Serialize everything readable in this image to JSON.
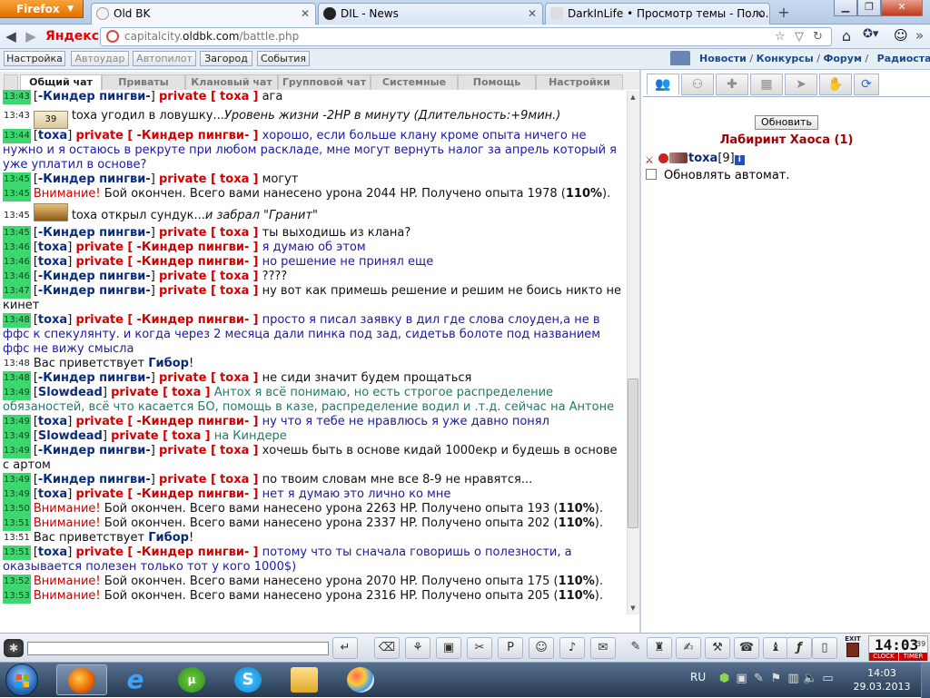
{
  "browser": {
    "app_button": "Firefox",
    "tabs": [
      {
        "label": "Old BK",
        "active": true
      },
      {
        "label": "DIL - News",
        "active": false
      },
      {
        "label": "DarkInLife • Просмотр темы - Поло...",
        "active": false
      }
    ],
    "new_tab": "+",
    "yandex": "Яндекс",
    "url_host": "capitalcity.",
    "url_domain": "oldbk.com",
    "url_path": "/battle.php"
  },
  "game_menu": {
    "buttons": [
      "Настройка",
      "Автоудар",
      "Автопилот",
      "Загород",
      "События"
    ],
    "links": [
      {
        "label": "Новости",
        "sep": " / "
      },
      {
        "label": "Конкурсы",
        "sep": " / "
      },
      {
        "label": "Форум",
        "sep": " / "
      },
      {
        "label": "Радиостанции",
        "sep": ""
      }
    ]
  },
  "chat_tabs": [
    "Общий чат",
    "Приваты",
    "Клановый чат",
    "Групповой чат",
    "Системные",
    "Помощь",
    "Настройки"
  ],
  "chat": [
    {
      "kind": "msg",
      "ts": "13:43",
      "bracket_open": "[",
      "nick": "-Киндер пингви-",
      "bracket_close": "]",
      "priv": "private [",
      "to": "toxa",
      "priv_close": "]",
      "text": "ага",
      "tone": "black",
      "ts_style": "green"
    },
    {
      "kind": "event",
      "ts": "13:43",
      "icon": "39",
      "actor": "toxa",
      "text": " угодил в ловушку...",
      "italic": "Уровень жизни -2HP в минуту (Длительность:+9мин.)"
    },
    {
      "kind": "msg",
      "ts": "13:44",
      "bracket_open": "[",
      "nick": "toxa",
      "bracket_close": "]",
      "priv": "private [",
      "to": "-Киндер пингви-",
      "priv_close": "]",
      "text": "хорошо, если больше клану кроме опыта ничего не нужно и я остаюсь в рекруте при любом раскладе, мне могут вернуть налог за апрель который я уже уплатил в основе?",
      "tone": "blue",
      "ts_style": "green"
    },
    {
      "kind": "msg",
      "ts": "13:45",
      "bracket_open": "[",
      "nick": "-Киндер пингви-",
      "bracket_close": "]",
      "priv": "private [",
      "to": "toxa",
      "priv_close": "]",
      "text": "могут",
      "tone": "black",
      "ts_style": "green"
    },
    {
      "kind": "system",
      "ts": "13:45",
      "warn": "Внимание!",
      "text": " Бой окончен. Всего вами нанесено урона 2044 HP. Получено опыта 1978 (",
      "pct": "110%",
      "tail": ")."
    },
    {
      "kind": "event",
      "ts": "13:45",
      "icon": "chest",
      "actor": "toxa",
      "text": " открыл сундук...",
      "italic": "и забрал \"Гранит\""
    },
    {
      "kind": "msg",
      "ts": "13:45",
      "bracket_open": "[",
      "nick": "-Киндер пингви-",
      "bracket_close": "]",
      "priv": "private [",
      "to": "toxa",
      "priv_close": "]",
      "text": "ты выходишь из клана?",
      "tone": "black",
      "ts_style": "green"
    },
    {
      "kind": "msg",
      "ts": "13:46",
      "bracket_open": "[",
      "nick": "toxa",
      "bracket_close": "]",
      "priv": "private [",
      "to": "-Киндер пингви-",
      "priv_close": "]",
      "text": "я думаю об этом",
      "tone": "blue",
      "ts_style": "green"
    },
    {
      "kind": "msg",
      "ts": "13:46",
      "bracket_open": "[",
      "nick": "toxa",
      "bracket_close": "]",
      "priv": "private [",
      "to": "-Киндер пингви-",
      "priv_close": "]",
      "text": "но решение не принял еще",
      "tone": "blue",
      "ts_style": "green"
    },
    {
      "kind": "msg",
      "ts": "13:46",
      "bracket_open": "[",
      "nick": "-Киндер пингви-",
      "bracket_close": "]",
      "priv": "private [",
      "to": "toxa",
      "priv_close": "]",
      "text": "????",
      "tone": "black",
      "ts_style": "green"
    },
    {
      "kind": "msg",
      "ts": "13:47",
      "bracket_open": "[",
      "nick": "-Киндер пингви-",
      "bracket_close": "]",
      "priv": "private [",
      "to": "toxa",
      "priv_close": "]",
      "text": "ну вот как примешь решение и решим не боись никто не кинет",
      "tone": "black",
      "ts_style": "green"
    },
    {
      "kind": "msg",
      "ts": "13:48",
      "bracket_open": "[",
      "nick": "toxa",
      "bracket_close": "]",
      "priv": "private [",
      "to": "-Киндер пингви-",
      "priv_close": "]",
      "text": "просто я писал заявку в дил где слова слоуден,а не в ффс к спекулянту. и когда через 2 месяца дали пинка под зад, сидетьв болоте под названием ффс не вижу смысла",
      "tone": "blue",
      "ts_style": "green"
    },
    {
      "kind": "greet",
      "ts": "13:48",
      "text": "Вас приветствует ",
      "name": "Гибор",
      "tail": "!"
    },
    {
      "kind": "msg",
      "ts": "13:48",
      "bracket_open": "[",
      "nick": "-Киндер пингви-",
      "bracket_close": "]",
      "priv": "private [",
      "to": "toxa",
      "priv_close": "]",
      "text": "не сиди значит будем прощаться",
      "tone": "black",
      "ts_style": "green"
    },
    {
      "kind": "msg",
      "ts": "13:49",
      "bracket_open": "[",
      "nick": "Slowdead",
      "bracket_close": "]",
      "priv": "private [",
      "to": "toxa",
      "priv_close": "]",
      "text": "Антох я всё понимаю, но есть строгое распределение обязаностей, всё что касается БО, помощь в казе, распределение водил и .т.д. сейчас на Антоне",
      "tone": "teal",
      "ts_style": "green"
    },
    {
      "kind": "msg",
      "ts": "13:49",
      "bracket_open": "[",
      "nick": "toxa",
      "bracket_close": "]",
      "priv": "private [",
      "to": "-Киндер пингви-",
      "priv_close": "]",
      "text": "ну что я тебе не нравлюсь я уже давно понял",
      "tone": "blue",
      "ts_style": "green"
    },
    {
      "kind": "msg",
      "ts": "13:49",
      "bracket_open": "[",
      "nick": "Slowdead",
      "bracket_close": "]",
      "priv": "private [",
      "to": "toxa",
      "priv_close": "]",
      "text": "на Киндере",
      "tone": "teal",
      "ts_style": "green"
    },
    {
      "kind": "msg",
      "ts": "13:49",
      "bracket_open": "[",
      "nick": "-Киндер пингви-",
      "bracket_close": "]",
      "priv": "private [",
      "to": "toxa",
      "priv_close": "]",
      "text": "хочешь быть в основе кидай 1000екр и будешь в основе с артом",
      "tone": "black",
      "ts_style": "green"
    },
    {
      "kind": "msg",
      "ts": "13:49",
      "bracket_open": "[",
      "nick": "-Киндер пингви-",
      "bracket_close": "]",
      "priv": "private [",
      "to": "toxa",
      "priv_close": "]",
      "text": "по твоим словам мне все 8-9 не нравятся...",
      "tone": "black",
      "ts_style": "green"
    },
    {
      "kind": "msg",
      "ts": "13:49",
      "bracket_open": "[",
      "nick": "toxa",
      "bracket_close": "]",
      "priv": "private [",
      "to": "-Киндер пингви-",
      "priv_close": "]",
      "text": "нет я думаю это лично ко мне",
      "tone": "blue",
      "ts_style": "green"
    },
    {
      "kind": "system",
      "ts": "13:50",
      "warn": "Внимание!",
      "text": " Бой окончен. Всего вами нанесено урона 2263 HP. Получено опыта 193 (",
      "pct": "110%",
      "tail": ")."
    },
    {
      "kind": "system",
      "ts": "13:51",
      "warn": "Внимание!",
      "text": " Бой окончен. Всего вами нанесено урона 2337 HP. Получено опыта 202 (",
      "pct": "110%",
      "tail": ")."
    },
    {
      "kind": "greet",
      "ts": "13:51",
      "text": "Вас приветствует ",
      "name": "Гибор",
      "tail": "!"
    },
    {
      "kind": "msg",
      "ts": "13:51",
      "bracket_open": "[",
      "nick": "toxa",
      "bracket_close": "]",
      "priv": "private [",
      "to": "-Киндер пингви-",
      "priv_close": "]",
      "text": "потому что ты сначала говоришь о полезности, а оказывается полезен только тот у кого 1000$)",
      "tone": "blue",
      "ts_style": "green"
    },
    {
      "kind": "system",
      "ts": "13:52",
      "warn": "Внимание!",
      "text": " Бой окончен. Всего вами нанесено урона 2070 HP. Получено опыта 175 (",
      "pct": "110%",
      "tail": ")."
    },
    {
      "kind": "system",
      "ts": "13:53",
      "warn": "Внимание!",
      "text": " Бой окончен. Всего вами нанесено урона 2316 HP. Получено опыта 205 (",
      "pct": "110%",
      "tail": ")."
    }
  ],
  "right": {
    "refresh_label": "Обновить",
    "room_title": "Лабиринт Хаоса (1)",
    "user": {
      "name": "toxa",
      "level": "[9]",
      "info": "i"
    },
    "auto_refresh_label": "Обновлять автомат.",
    "auto_refresh_checked": false
  },
  "clock": {
    "time": "14:03",
    "seconds": "39",
    "label_left": "CLOCK",
    "label_right": "TIMER"
  },
  "exit_label": "EXIT",
  "taskbar": {
    "lang": "RU",
    "time": "14:03",
    "date": "29.03.2013"
  }
}
